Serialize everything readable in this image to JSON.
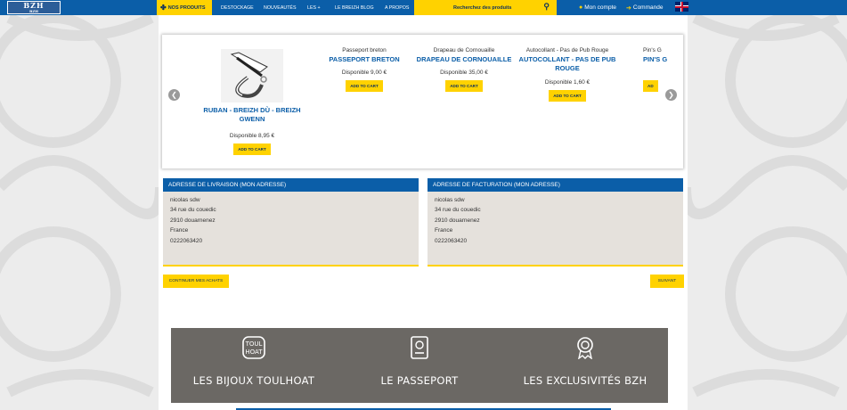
{
  "header": {
    "logo_text": "BZH",
    "logo_sub": "BZH",
    "nav_products": "NOS PRODUITS",
    "nav_links": [
      "DESTOCKAGE",
      "NOUVEAUTÉS",
      "LES +",
      "LE BREIZH BLOG",
      "A PROPOS"
    ],
    "search_placeholder": "Recherchez des produits",
    "account": "Mon compte",
    "order": "Commande"
  },
  "carousel": {
    "products": [
      {
        "subtitle": "",
        "title": "RUBAN - BREIZH DÙ - BREIZH GWENN",
        "price": "Disponible 8,95 €",
        "button": "ADD TO CART"
      },
      {
        "subtitle": "Passeport breton",
        "title": "PASSEPORT BRETON",
        "price": "Disponible 9,00 €",
        "button": "ADD TO CART"
      },
      {
        "subtitle": "Drapeau de Cornouaille",
        "title": "DRAPEAU DE CORNOUAILLE",
        "price": "Disponible 35,00 €",
        "button": "ADD TO CART"
      },
      {
        "subtitle": "Autocollant - Pas de Pub Rouge",
        "title": "AUTOCOLLANT - PAS DE PUB ROUGE",
        "price": "Disponible 1,60 €",
        "button": "ADD TO CART"
      },
      {
        "subtitle": "Pin's G",
        "title": "PIN'S G",
        "price": "",
        "button": "AD"
      }
    ]
  },
  "shipping": {
    "title": "ADRESSE DE LIVRAISON (MON ADRESSE)",
    "name": "nicolas sdw",
    "street": "34 rue du couedic",
    "city": "2910 douarnenez",
    "country": "France",
    "phone": "0222063420"
  },
  "billing": {
    "title": "ADRESSE DE FACTURATION (MON ADRESSE)",
    "name": "nicolas sdw",
    "street": "34 rue du couedic",
    "city": "2910 douarnenez",
    "country": "France",
    "phone": "0222063420"
  },
  "buttons": {
    "continue": "CONTINUER MES ACHATS",
    "next": "SUIVANT"
  },
  "categories": [
    {
      "label": "LES BIJOUX TOULHOAT",
      "icon": "toulhoat-logo-icon"
    },
    {
      "label": "LE PASSEPORT",
      "icon": "passport-icon"
    },
    {
      "label": "LES EXCLUSIVITÉS BZH",
      "icon": "award-ribbon-icon"
    }
  ],
  "colors": {
    "nav_blue": "#0b5ea8",
    "accent_yellow": "#ffd200",
    "tile_gray": "#6b6864",
    "address_bg": "#e5e1dc"
  }
}
